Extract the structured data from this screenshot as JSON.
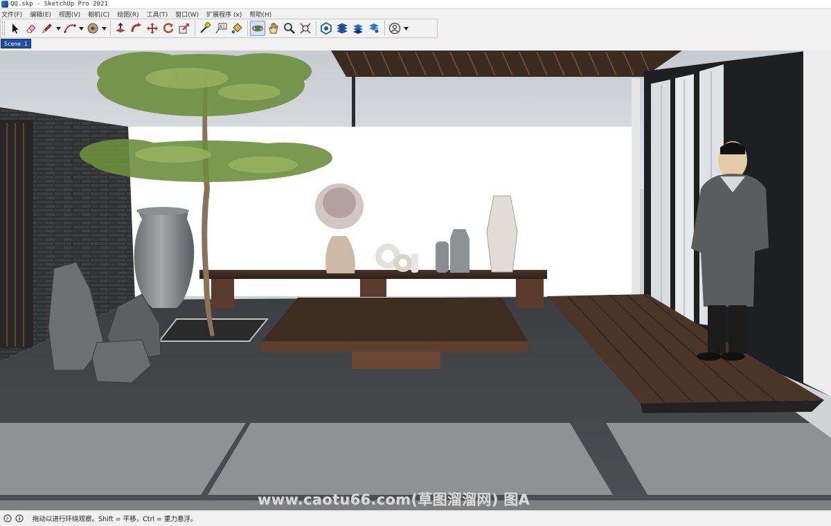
{
  "window": {
    "title": "QQ.skp - SketchUp Pro 2021"
  },
  "menu": [
    "文件(F)",
    "编辑(E)",
    "视图(V)",
    "相机(C)",
    "绘图(R)",
    "工具(T)",
    "窗口(W)",
    "扩展程序 (x)",
    "帮助(H)"
  ],
  "toolbar": {
    "tools": [
      "select-tool",
      "eraser-tool",
      "line-tool",
      "arc-tool",
      "shapes-tool",
      "push-pull-tool",
      "follow-me-tool",
      "move-tool",
      "rotate-tool",
      "scale-tool",
      "tape-measure-tool",
      "text-tool",
      "paint-bucket-tool",
      "orbit-tool",
      "pan-tool",
      "zoom-tool",
      "zoom-extents-tool",
      "3d-warehouse",
      "extension-warehouse",
      "layout",
      "extension-manager",
      "account"
    ],
    "active_tool": "orbit-tool",
    "text_tool_label": "A1"
  },
  "scenes": {
    "tabs": [
      "Scene 1"
    ],
    "active": "Scene 1"
  },
  "viewport": {
    "watermark": "www.caotu66.com(草图溜溜网) 图A"
  },
  "status": {
    "text": "拖动以进行环绕观察。Shift = 平移，Ctrl = 重力悬浮。"
  },
  "colors": {
    "tab_active": "#1f4fa0",
    "active_tool_bg": "#cfe3f7"
  }
}
